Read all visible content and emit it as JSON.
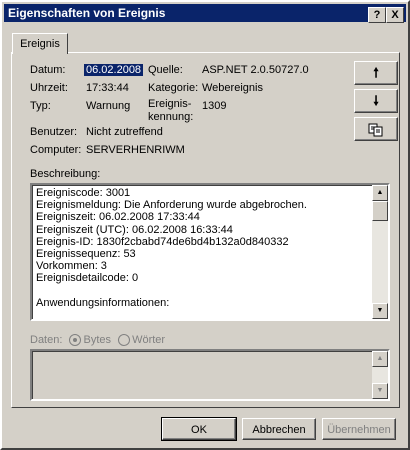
{
  "window": {
    "title": "Eigenschaften von Ereignis",
    "help_label": "?",
    "close_label": "X"
  },
  "tabs": [
    {
      "label": "Ereignis"
    }
  ],
  "fields": {
    "datum_label": "Datum:",
    "datum_value": "06.02.2008",
    "uhrzeit_label": "Uhrzeit:",
    "uhrzeit_value": "17:33:44",
    "typ_label": "Typ:",
    "typ_value": "Warnung",
    "benutzer_label": "Benutzer:",
    "benutzer_value": "Nicht zutreffend",
    "computer_label": "Computer:",
    "computer_value": "SERVERHENRIWM",
    "quelle_label": "Quelle:",
    "quelle_value": "ASP.NET 2.0.50727.0",
    "kategorie_label": "Kategorie:",
    "kategorie_value": "Webereignis",
    "kennung_label_1": "Ereignis-",
    "kennung_label_2": "kennung:",
    "kennung_value": "1309"
  },
  "nav": {
    "up_icon": "arrow-up-icon",
    "down_icon": "arrow-down-icon",
    "copy_icon": "copy-icon"
  },
  "description": {
    "label": "Beschreibung:",
    "lines": [
      "Ereigniscode: 3001",
      "Ereignismeldung: Die Anforderung wurde abgebrochen.",
      "Ereigniszeit: 06.02.2008 17:33:44",
      "Ereigniszeit (UTC): 06.02.2008 16:33:44",
      "Ereignis-ID: 1830f2cbabd74de6bd4b132a0d840332",
      "Ereignissequenz: 53",
      "Vorkommen: 3",
      "Ereignisdetailcode: 0",
      "",
      "Anwendungsinformationen:"
    ]
  },
  "data_section": {
    "label": "Daten:",
    "bytes_label": "Bytes",
    "words_label": "Wörter",
    "selected": "Bytes"
  },
  "buttons": {
    "ok": "OK",
    "cancel": "Abbrechen",
    "apply": "Übernehmen"
  },
  "colors": {
    "titlebar": "#0a246a",
    "face": "#d4d0c8",
    "disabled_text": "#808080"
  }
}
